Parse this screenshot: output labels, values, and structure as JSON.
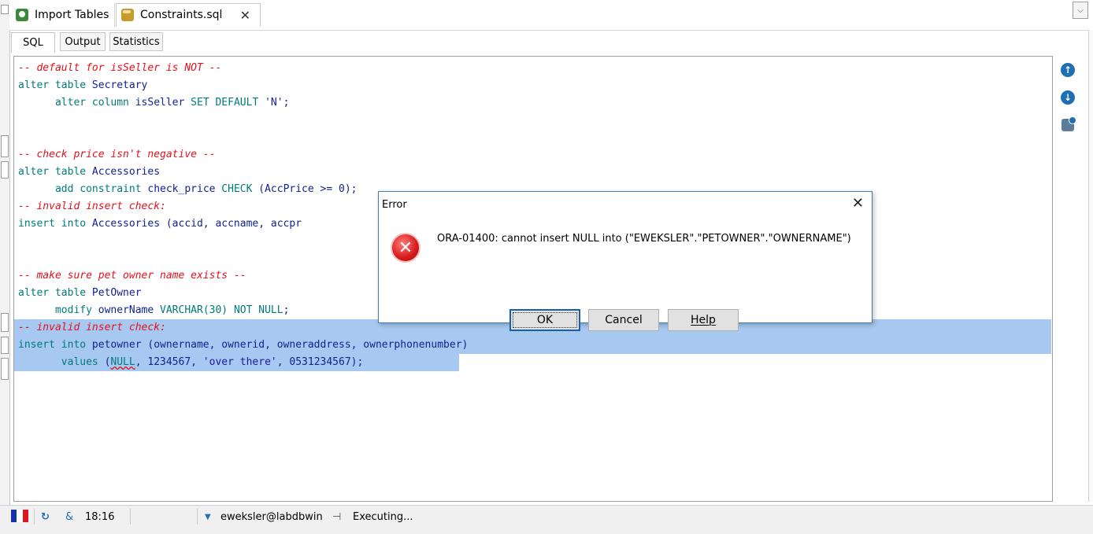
{
  "editor_tabs": [
    {
      "label": "Import Tables",
      "icon": "import-tables-icon"
    },
    {
      "label": "Constraints.sql",
      "icon": "sql-file-icon",
      "active": true
    }
  ],
  "sub_tabs": [
    "SQL",
    "Output",
    "Statistics"
  ],
  "code_lines": [
    [
      {
        "t": "-- default for isSeller is NOT --",
        "c": "c"
      }
    ],
    [
      {
        "t": "alter table ",
        "c": "k"
      },
      {
        "t": "Secretary",
        "c": "i"
      }
    ],
    [
      {
        "t": "      alter column ",
        "c": "k"
      },
      {
        "t": "isSeller ",
        "c": "i"
      },
      {
        "t": "SET DEFAULT ",
        "c": "k"
      },
      {
        "t": "'N'",
        "c": "s"
      },
      {
        "t": ";",
        "c": "i"
      }
    ],
    [],
    [],
    [
      {
        "t": "-- check price isn't negative --",
        "c": "c"
      }
    ],
    [
      {
        "t": "alter table ",
        "c": "k"
      },
      {
        "t": "Accessories",
        "c": "i"
      }
    ],
    [
      {
        "t": "      add constraint ",
        "c": "k"
      },
      {
        "t": "check_price ",
        "c": "i"
      },
      {
        "t": "CHECK ",
        "c": "k"
      },
      {
        "t": "(AccPrice >= 0);",
        "c": "i"
      }
    ],
    [
      {
        "t": "-- invalid insert check:",
        "c": "c"
      }
    ],
    [
      {
        "t": "insert into ",
        "c": "k"
      },
      {
        "t": "Accessories (accid, accname, accpr",
        "c": "i"
      }
    ],
    [],
    [],
    [
      {
        "t": "-- make sure pet owner name exists --",
        "c": "c"
      }
    ],
    [
      {
        "t": "alter table ",
        "c": "k"
      },
      {
        "t": "PetOwner",
        "c": "i"
      }
    ],
    [
      {
        "t": "      modify ",
        "c": "k"
      },
      {
        "t": "ownerName ",
        "c": "i"
      },
      {
        "t": "VARCHAR(30) NOT NULL",
        "c": "k"
      },
      {
        "t": ";",
        "c": "i"
      }
    ],
    [
      {
        "t": "-- invalid insert check:",
        "c": "c"
      }
    ],
    [
      {
        "t": "insert into ",
        "c": "k"
      },
      {
        "t": "petowner (ownername, ownerid, owneraddress, ownerphonenumber)",
        "c": "i"
      }
    ],
    [
      {
        "t": "       values ",
        "c": "k"
      },
      {
        "t": "(",
        "c": "i"
      },
      {
        "t": "NULL",
        "c": "k",
        "squiggle": true
      },
      {
        "t": ", 1234567, ",
        "c": "i"
      },
      {
        "t": "'over there'",
        "c": "s"
      },
      {
        "t": ", 0531234567);",
        "c": "i"
      }
    ]
  ],
  "selected_lines": [
    15,
    16,
    17
  ],
  "dialog": {
    "title": "Error",
    "message": "ORA-01400: cannot insert NULL into (\"EWEKSLER\".\"PETOWNER\".\"OWNERNAME\")",
    "ok_label": "OK",
    "cancel_label": "Cancel",
    "help_label": "Help"
  },
  "right_toolbar": [
    "arrow-up-circle-icon",
    "arrow-down-circle-icon",
    "database-settings-icon"
  ],
  "status": {
    "time": "18:16",
    "connection": "eweksler@labdbwin",
    "state": "Executing..."
  },
  "colors": {
    "comment": "#e3121d",
    "keyword": "#007a7a",
    "identifier": "#11238f",
    "selection": "#a7c8f0",
    "dialog_border": "#3c7fb1"
  }
}
